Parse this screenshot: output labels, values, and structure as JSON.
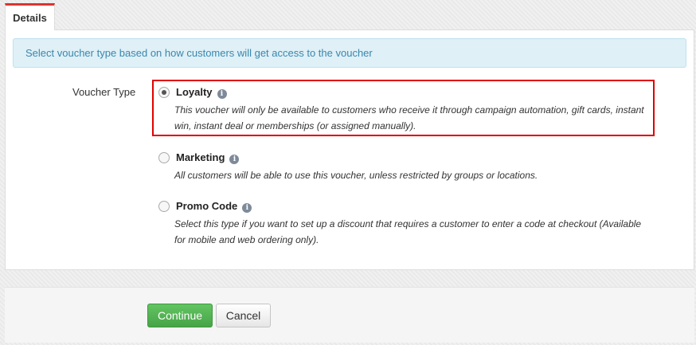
{
  "tabs": [
    {
      "label": "Details",
      "active": true
    }
  ],
  "info_message": "Select voucher type based on how customers will get access to the voucher",
  "form": {
    "field_label": "Voucher Type",
    "options": [
      {
        "label": "Loyalty",
        "checked": true,
        "highlighted": true,
        "description": "This voucher will only be available to customers who receive it through campaign automation, gift cards, instant win, instant deal or memberships (or assigned manually)."
      },
      {
        "label": "Marketing",
        "checked": false,
        "description": "All customers will be able to use this voucher, unless restricted by groups or locations."
      },
      {
        "label": "Promo Code",
        "checked": false,
        "description": "Select this type if you want to set up a discount that requires a customer to enter a code at checkout (Available for mobile and web ordering only)."
      }
    ]
  },
  "buttons": {
    "continue_label": "Continue",
    "cancel_label": "Cancel"
  },
  "icons": {
    "option_info": "info-icon",
    "info_glyph": "i"
  },
  "colors": {
    "accent_tab": "#d9352f",
    "info_bg": "#dff0f7",
    "info_text": "#3a87ad",
    "continue_bg": "#5cb85c",
    "highlight": "#e00000"
  }
}
